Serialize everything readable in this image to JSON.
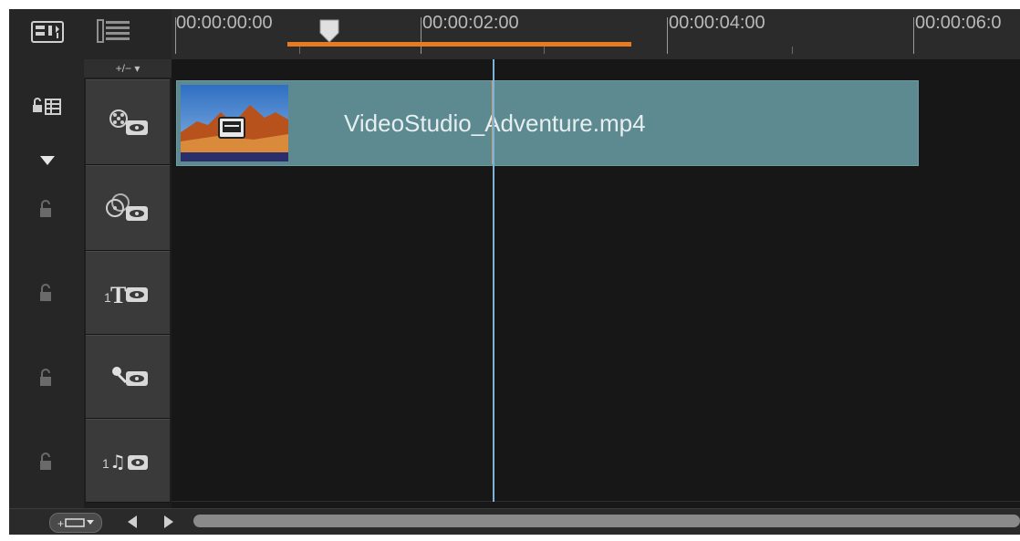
{
  "toolbar": {
    "storyboard_view_icon": "storyboard-view-icon",
    "timeline_view_icon": "timeline-view-icon"
  },
  "ruler": {
    "time_labels": [
      "00:00:00:00",
      "00:00:02:00",
      "00:00:04:00",
      "00:00:06:0"
    ]
  },
  "tracks": {
    "add_remove_label": "+/− ▾",
    "video_clip": {
      "name": "VideoStudio_Adventure.mp4"
    },
    "track_headers": [
      {
        "name": "video-track",
        "icon": "film-reel-eye-icon"
      },
      {
        "name": "overlay-track",
        "icon": "overlay-reel-eye-icon"
      },
      {
        "name": "title-track",
        "icon": "title-t-eye-icon",
        "prefix": "1"
      },
      {
        "name": "voice-track",
        "icon": "microphone-eye-icon"
      },
      {
        "name": "music-track",
        "icon": "music-note-eye-icon",
        "prefix": "1"
      }
    ]
  },
  "colors": {
    "clip": "#5c8a90",
    "work_range": "#e87a22",
    "playhead": "#7fb3d6",
    "background": "#1a1a1a"
  }
}
